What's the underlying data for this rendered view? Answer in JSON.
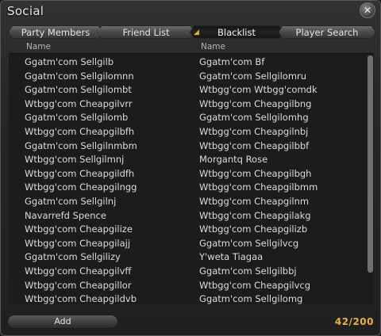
{
  "window": {
    "title": "Social"
  },
  "tabs": [
    {
      "label": "Party Members",
      "active": false
    },
    {
      "label": "Friend List",
      "active": false
    },
    {
      "label": "Blacklist",
      "active": true
    },
    {
      "label": "Player Search",
      "active": false
    }
  ],
  "columns": [
    "Name",
    "Name"
  ],
  "rows": [
    [
      "Ggatm'com Sellgilb",
      "Ggatm'com Bf"
    ],
    [
      "Ggatm'com Sellgilomnn",
      "Ggatm'com Sellgilomru"
    ],
    [
      "Ggatm'com Sellgilombt",
      "Wtbgg'com Wtbgg'comdk"
    ],
    [
      "Wtbgg'com Cheapgilvrr",
      "Wtbgg'com Cheapgilbng"
    ],
    [
      "Ggatm'com Sellgilomb",
      "Ggatm'com Sellgilomhg"
    ],
    [
      "Wtbgg'com Cheapgilbfh",
      "Wtbgg'com Cheapgilnbj"
    ],
    [
      "Ggatm'com Sellgilnmbm",
      "Wtbgg'com Cheapgilbbf"
    ],
    [
      "Wtbgg'com Sellgilmnj",
      "Morgantq Rose"
    ],
    [
      "Wtbgg'com Cheapgildfh",
      "Wtbgg'com Cheapgilbgh"
    ],
    [
      "Wtbgg'com Cheapgilngg",
      "Wtbgg'com Cheapgilbmm"
    ],
    [
      "Ggatm'com Sellgilnj",
      "Wtbgg'com Cheapgilnm"
    ],
    [
      "Navarrefd Spence",
      "Wtbgg'com Cheapgilakg"
    ],
    [
      "Wtbgg'com Cheapgilize",
      "Wtbgg'com Cheapgilizb"
    ],
    [
      "Wtbgg'com Cheapgilajj",
      "Ggatm'com Sellgilvcg"
    ],
    [
      "Ggatm'com Sellgilizy",
      "Y'weta Tiagaa"
    ],
    [
      "Wtbgg'com Cheapgilvff",
      "Ggatm'com Sellgilbbj"
    ],
    [
      "Wtbgg'com Cheapgillor",
      "Wtbgg'com Cheapgilvcg"
    ],
    [
      "Wtbgg'com Cheapgildvb",
      "Ggatm'com Sellgilomg"
    ]
  ],
  "footer": {
    "add_label": "Add",
    "count": "42/200"
  },
  "icons": {
    "close": "close-icon",
    "tab_marker": "tab-marker-icon"
  },
  "colors": {
    "accent": "#e8b040"
  }
}
